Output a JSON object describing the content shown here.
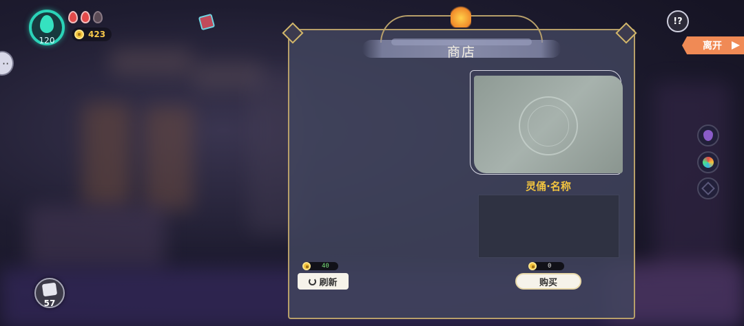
{
  "hud": {
    "hp": "120",
    "coins": "423",
    "deck_count": "57"
  },
  "top_right": {
    "help_label": "!?",
    "leave_label": "离开"
  },
  "shop": {
    "title": "商店",
    "item_name": "灵俑·名称",
    "item_description": "",
    "refresh_price": "40",
    "refresh_label": "刷新",
    "buy_price": "0",
    "buy_label": "购买"
  },
  "colors": {
    "hp_ring": "#2bd3b8",
    "coin": "#f3c23a",
    "leave_button": "#f08a55",
    "item_name": "#f2c440",
    "panel_border": "#b8a06a"
  },
  "icons": {
    "hp": "spirit-flame-icon",
    "life_drops": [
      "red-drop-icon",
      "red-drop-icon",
      "empty-drop-icon"
    ],
    "book": "book-icon",
    "deck": "card-deck-icon",
    "side_items": [
      "grape-icon",
      "flower-bouquet-icon",
      "dark-star-icon"
    ]
  }
}
